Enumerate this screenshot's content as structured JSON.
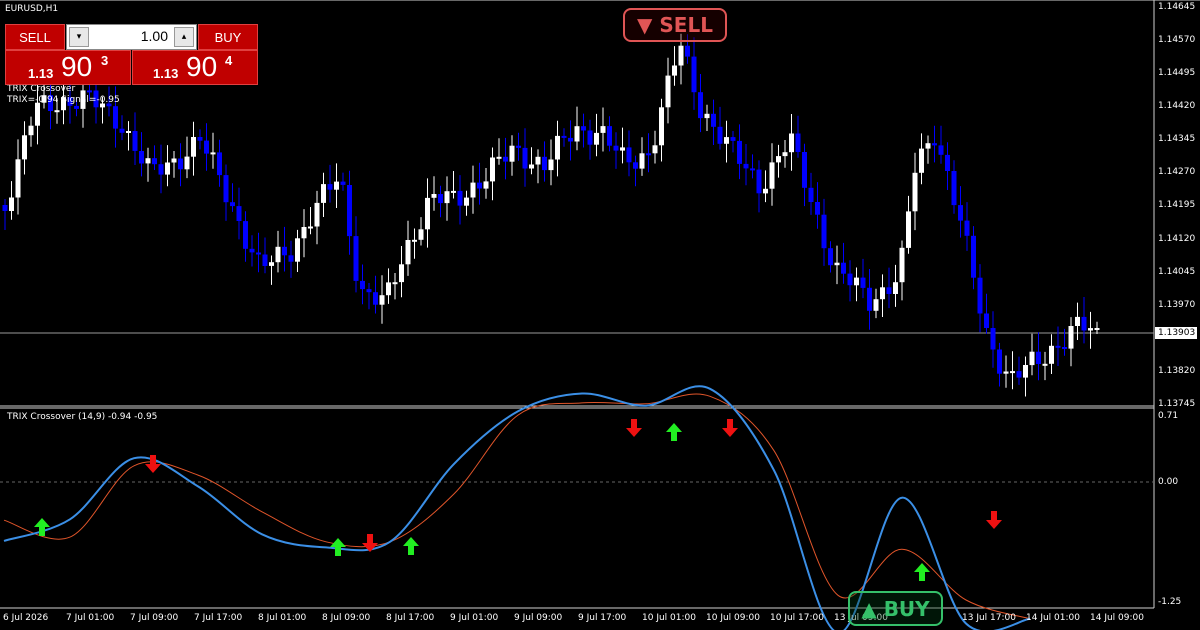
{
  "symbol_title": "EURUSD,H1",
  "trade_panel": {
    "sell_label": "SELL",
    "buy_label": "BUY",
    "lot_value": "1.00",
    "lot_minus_icon": "minus-icon",
    "lot_plus_icon": "plus-icon",
    "sell_price_small": "1.13",
    "sell_price_big": "90",
    "sell_price_sup": "3",
    "buy_price_small": "1.13",
    "buy_price_big": "90",
    "buy_price_sup": "4"
  },
  "indicator_overlay": {
    "line1": "TRIX Crossover",
    "line2": "TRIX=-0.94  Signal=-0.95"
  },
  "price_axis": [
    "1.14645",
    "1.14570",
    "1.14495",
    "1.14420",
    "1.14345",
    "1.14270",
    "1.14195",
    "1.14120",
    "1.14045",
    "1.13970",
    "1.13820",
    "1.13745"
  ],
  "current_price": "1.13903",
  "indicator_panel": {
    "title": "TRIX Crossover (14,9) -0.94 -0.95",
    "axis_labels": [
      "0.71",
      "0.00",
      "-1.25"
    ]
  },
  "time_axis": [
    "6 Jul 2026",
    "7 Jul 01:00",
    "7 Jul 09:00",
    "7 Jul 17:00",
    "8 Jul 01:00",
    "8 Jul 09:00",
    "8 Jul 17:00",
    "9 Jul 01:00",
    "9 Jul 09:00",
    "9 Jul 17:00",
    "10 Jul 01:00",
    "10 Jul 09:00",
    "10 Jul 17:00",
    "13 Jul 09:00",
    "13 Jul 17:00",
    "14 Jul 01:00",
    "14 Jul 09:00"
  ],
  "signals": {
    "sell_badge": "▼ SELL",
    "buy_badge": "▲ BUY"
  },
  "colors": {
    "background": "#000000",
    "bull_candle": "#ffffff",
    "bear_candle": "#0000ff",
    "trix_line": "#3b8fe6",
    "signal_line": "#e0552a",
    "up_arrow": "#22ee22",
    "down_arrow": "#ee1111",
    "sell_button": "#c00000"
  },
  "chart_data": {
    "type": "line",
    "title": "TRIX Crossover (14,9) -0.94 -0.95",
    "x": [
      "6 Jul 2026",
      "7 Jul 01:00",
      "7 Jul 09:00",
      "7 Jul 17:00",
      "8 Jul 01:00",
      "8 Jul 09:00",
      "8 Jul 17:00",
      "9 Jul 01:00",
      "9 Jul 09:00",
      "9 Jul 17:00",
      "10 Jul 01:00",
      "10 Jul 09:00",
      "10 Jul 17:00",
      "13 Jul 09:00",
      "13 Jul 17:00",
      "14 Jul 01:00",
      "14 Jul 09:00"
    ],
    "series": [
      {
        "name": "TRIX",
        "values": [
          -0.62,
          -0.39,
          0.26,
          -0.04,
          -0.55,
          -0.69,
          -0.63,
          0.2,
          0.76,
          0.95,
          0.82,
          1.0,
          0.13,
          -1.6,
          -0.16,
          -1.5,
          -1.45
        ]
      },
      {
        "name": "Signal",
        "values": [
          -0.4,
          -0.58,
          0.18,
          0.08,
          -0.31,
          -0.63,
          -0.63,
          -0.12,
          0.72,
          0.85,
          0.84,
          0.92,
          0.34,
          -1.2,
          -0.71,
          -1.25,
          -1.45
        ]
      }
    ],
    "ylim": [
      -1.25,
      0.71
    ],
    "grid": false
  }
}
